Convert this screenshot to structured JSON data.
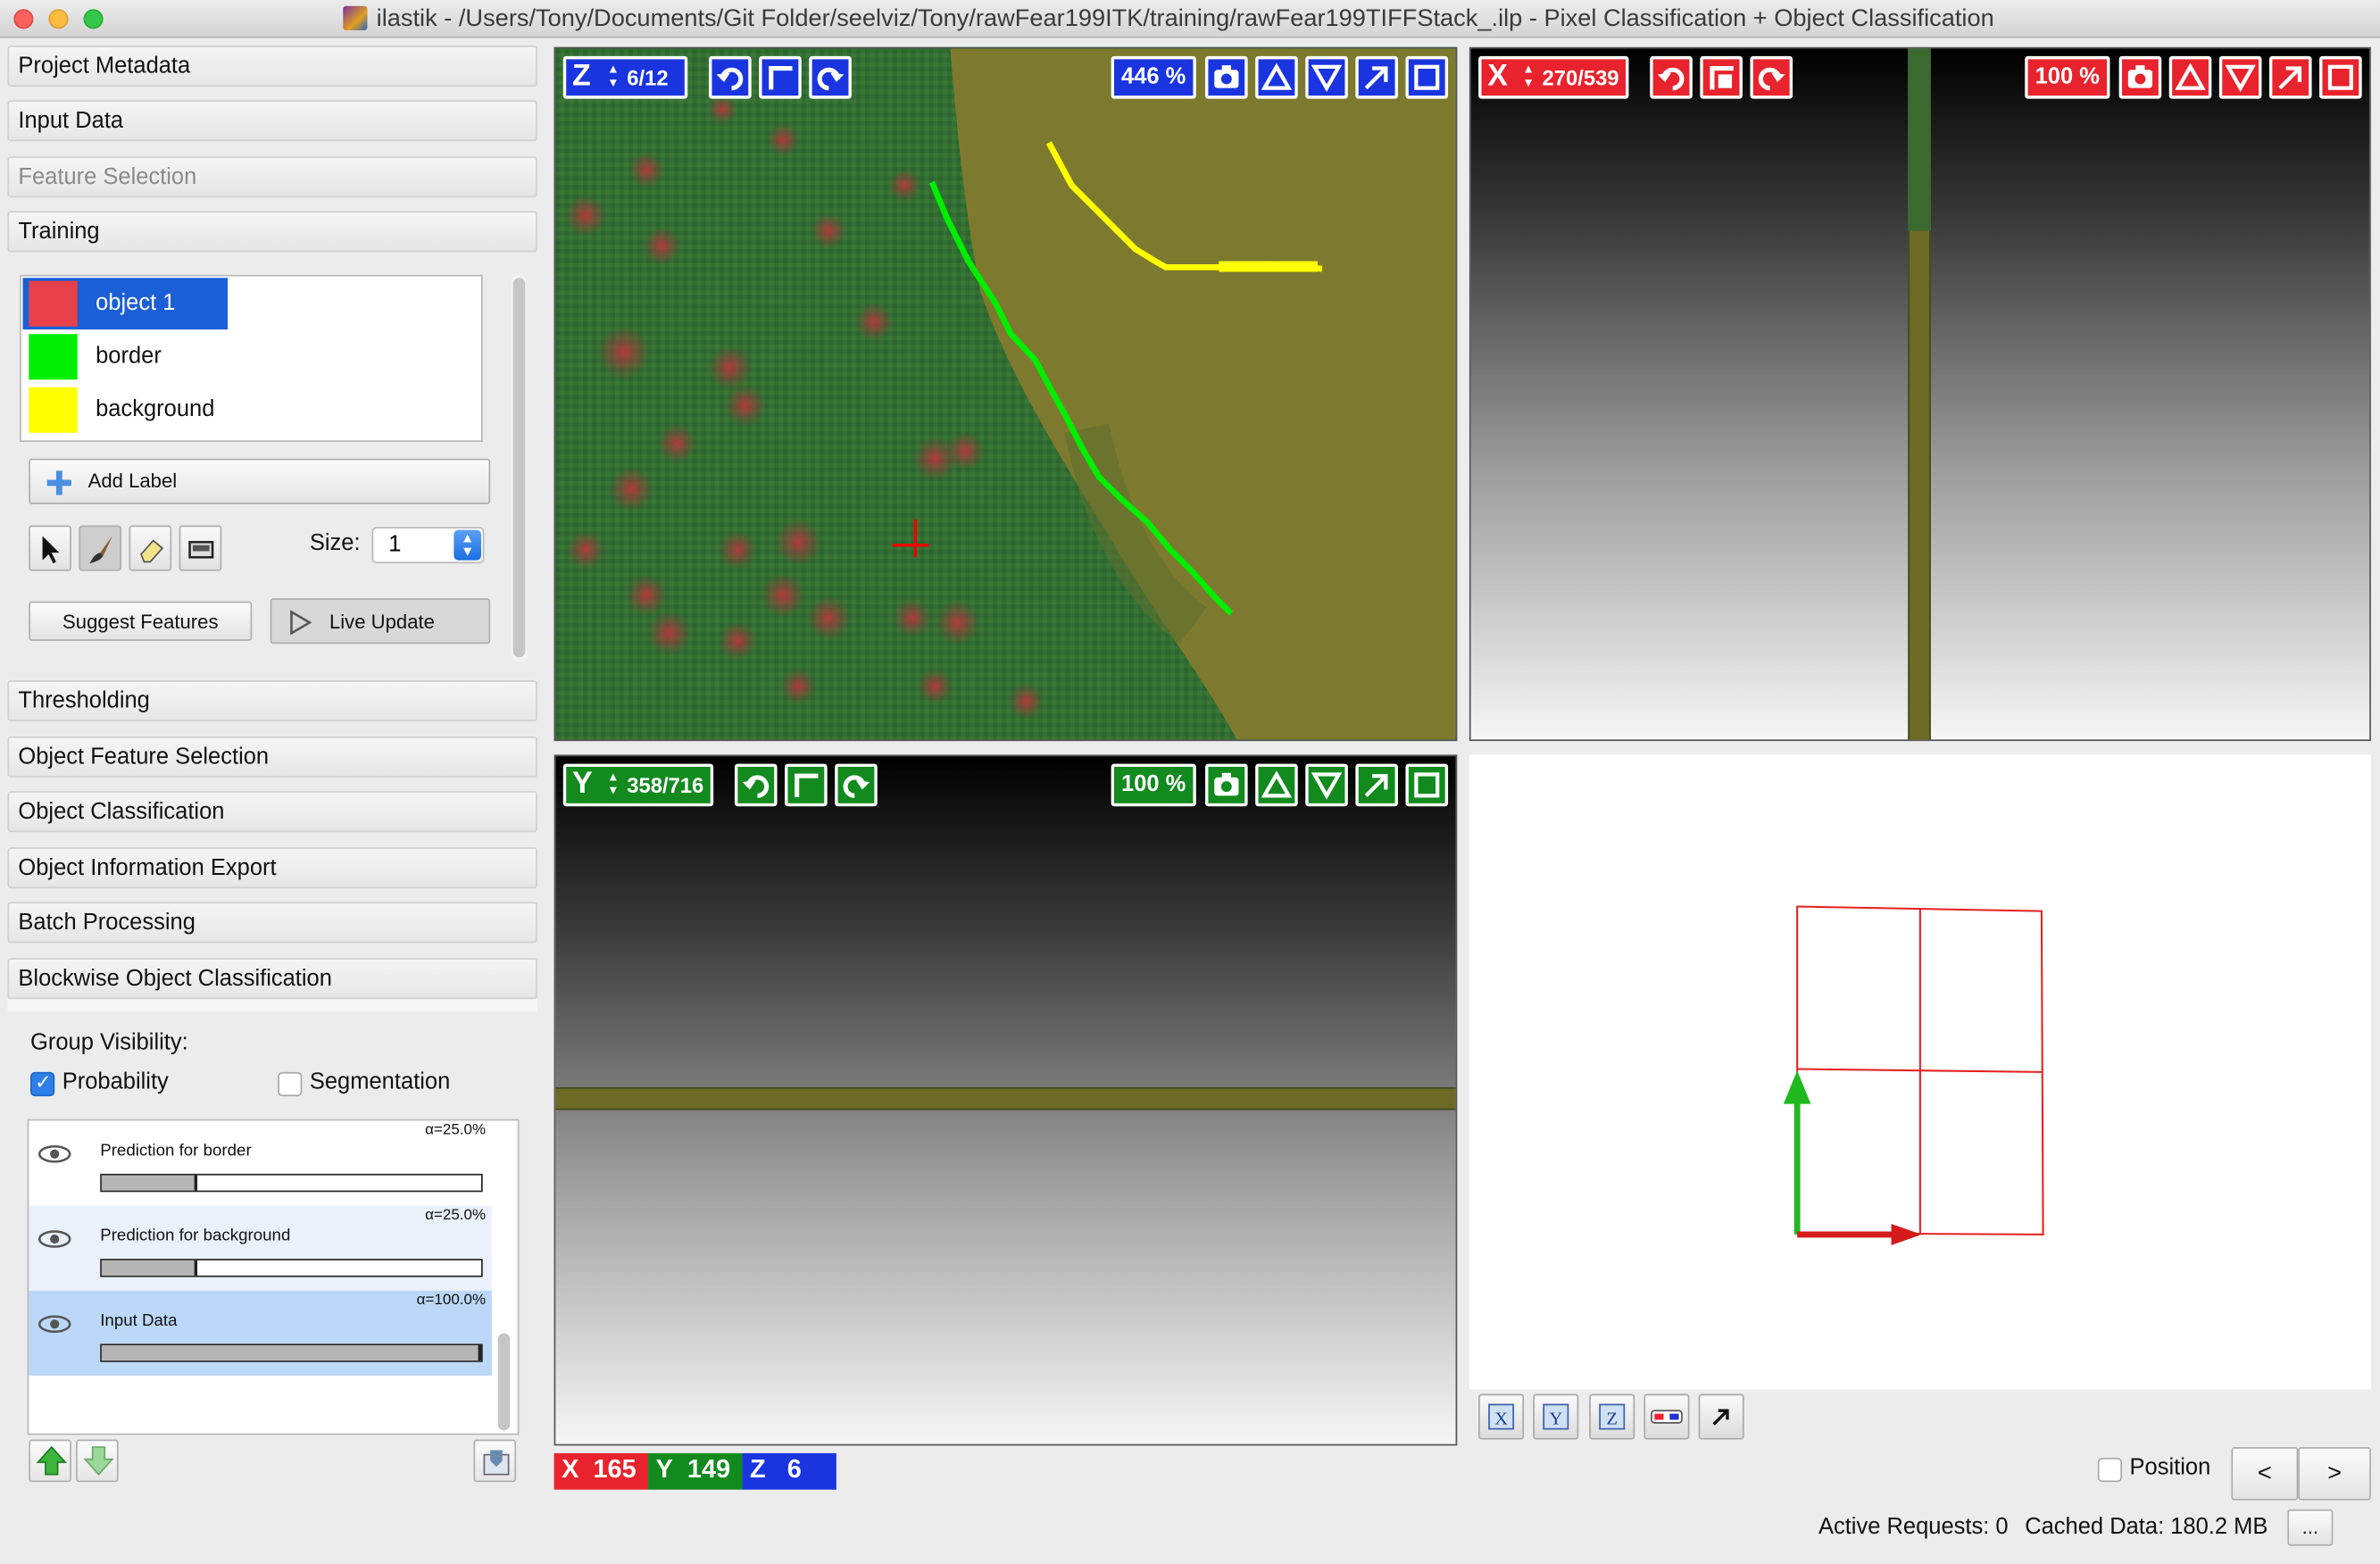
{
  "window": {
    "title": "ilastik - /Users/Tony/Documents/Git Folder/seelviz/Tony/rawFear199ITK/training/rawFear199TIFFStack_.ilp - Pixel Classification + Object Classification"
  },
  "applets": [
    {
      "label": "Project Metadata",
      "enabled": true
    },
    {
      "label": "Input Data",
      "enabled": true
    },
    {
      "label": "Feature Selection",
      "enabled": false
    },
    {
      "label": "Training",
      "enabled": true
    },
    {
      "label": "Thresholding",
      "enabled": true
    },
    {
      "label": "Object Feature Selection",
      "enabled": true
    },
    {
      "label": "Object Classification",
      "enabled": true
    },
    {
      "label": "Object Information Export",
      "enabled": true
    },
    {
      "label": "Batch Processing",
      "enabled": true
    },
    {
      "label": "Blockwise Object Classification",
      "enabled": true
    }
  ],
  "training": {
    "labels": [
      {
        "name": "object 1",
        "color": "#e8404a",
        "selected": true
      },
      {
        "name": "border",
        "color": "#00ee00",
        "selected": false
      },
      {
        "name": "background",
        "color": "#ffff00",
        "selected": false
      }
    ],
    "add_label": "Add Label",
    "size_label": "Size:",
    "size_value": "1",
    "suggest_features": "Suggest Features",
    "live_update": "Live Update",
    "tools": [
      "pointer-icon",
      "brush-icon",
      "eraser-icon",
      "selection-rect-icon"
    ]
  },
  "visibility": {
    "group_label": "Group Visibility:",
    "probability": {
      "label": "Probability",
      "checked": true
    },
    "segmentation": {
      "label": "Segmentation",
      "checked": false
    }
  },
  "layers": [
    {
      "name": "Prediction for border",
      "alpha": "α=25.0%",
      "opacity": 0.25
    },
    {
      "name": "Prediction for background",
      "alpha": "α=25.0%",
      "opacity": 0.25
    },
    {
      "name": "Input Data",
      "alpha": "α=100.0%",
      "opacity": 1.0
    }
  ],
  "views": {
    "z": {
      "axis": "Z",
      "slice": "6/12",
      "zoom": "446 %",
      "color": "#1a35e0"
    },
    "x": {
      "axis": "X",
      "slice": "270/539",
      "zoom": "100 %",
      "color": "#e8232d"
    },
    "y": {
      "axis": "Y",
      "slice": "358/716",
      "zoom": "100 %",
      "color": "#128a1e"
    }
  },
  "view3d_buttons": [
    "x-plane-icon",
    "y-plane-icon",
    "z-plane-icon",
    "anaglyph-icon",
    "expand-icon"
  ],
  "coordinates": {
    "x_label": "X",
    "x": "165",
    "y_label": "Y",
    "y": "149",
    "z_label": "Z",
    "z": "6"
  },
  "position": {
    "label": "Position",
    "checked": false
  },
  "nav": {
    "prev": "<",
    "next": ">"
  },
  "status": {
    "active_requests": "Active Requests: 0",
    "cached_data": "Cached Data: 180.2 MB",
    "more": "..."
  }
}
